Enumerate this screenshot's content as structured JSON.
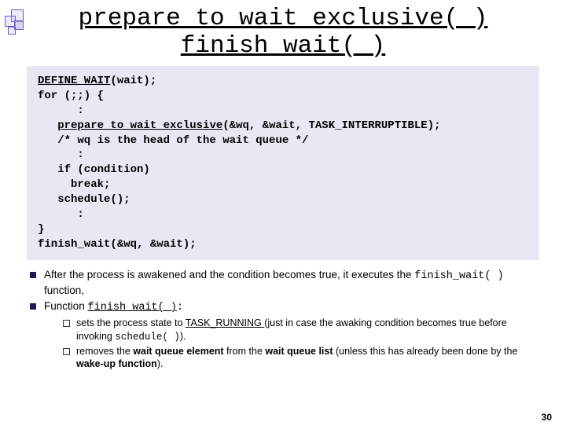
{
  "title_line1": "prepare_to_wait_exclusive( )",
  "title_line2": " finish_wait( )",
  "code": {
    "l1a": "DEFINE_WAIT",
    "l1b": "(wait);",
    "l2": "for (;;) {",
    "l3": "      :",
    "l4a": "   ",
    "l4b": "prepare_to_wait_exclusive",
    "l4c": "(&wq, &wait, TASK_INTERRUPTIBLE);",
    "l5": "   /* wq is the head of the wait queue */",
    "l6": "      :",
    "l7": "   if (condition)",
    "l8": "     break;",
    "l9": "   schedule();",
    "l10": "      :",
    "l11": "}",
    "l12": "finish_wait(&wq, &wait);"
  },
  "para1_a": "After the process is awakened and the condition becomes true, it executes the ",
  "para1_b": "finish_wait( )",
  "para1_c": " function,",
  "para2_a": "Function ",
  "para2_b": "finish_wait( )",
  "para2_c": ":",
  "sub1_a": "sets the process state to ",
  "sub1_b": "TASK_RUNNING ",
  "sub1_c": "(just in case the awaking condition becomes true before invoking ",
  "sub1_d": "schedule( )",
  "sub1_e": ").",
  "sub2_a": "removes the ",
  "sub2_b": "wait queue element",
  "sub2_c": " from the ",
  "sub2_d": "wait queue list",
  "sub2_e": " (unless this has already been done by the ",
  "sub2_f": "wake-up function",
  "sub2_g": ").",
  "page": "30"
}
